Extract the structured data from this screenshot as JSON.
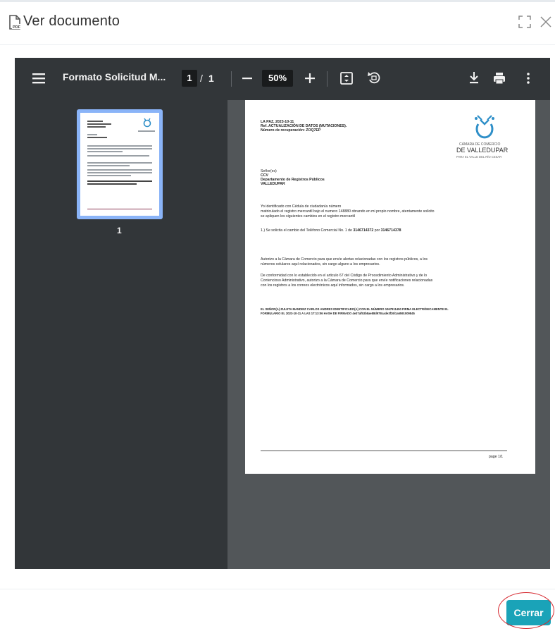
{
  "modal": {
    "title": "Ver documento",
    "title_icon": "pdf-file-icon",
    "expand_icon": "fullscreen-icon",
    "close_icon": "close-icon",
    "close_button_label": "Cerrar",
    "accent_color": "#1aa3b8"
  },
  "viewer": {
    "doc_title": "Formato Solicitud M...",
    "page_current": "1",
    "page_separator": "/",
    "page_total": "1",
    "zoom": "50%",
    "thumbnail_label": "1",
    "toolbar_icons": [
      "menu-icon",
      "zoom-out-icon",
      "zoom-in-icon",
      "fit-page-icon",
      "rotate-icon",
      "download-icon",
      "print-icon",
      "more-icon"
    ]
  },
  "document": {
    "line1": "LA PAZ, 2023-10-11",
    "line2": "Ref. ACTUALIZACIÓN DE DATOS (MUTACIONES).",
    "line3": "Número de recuperación: ZOQ7EP",
    "logo_line1": "CÁMARA DE COMERCIO",
    "logo_line2": "DE VALLEDUPAR",
    "logo_line3": "PARA EL VALLE DEL RÍO CESAR",
    "salutation": "Señor(es)",
    "addr1": "CCV",
    "addr2": "Departamento de Registros Públicos",
    "addr3": "VALLEDUPAR",
    "p1a": "Yo                                                              identificado con Cédula de ciudadanía número",
    "p1b": "matriculado el registro mercantil bajo el numero 148880 obrando en mi propio nombre, atentamente solicito",
    "p1c": "se apliquen los siguientes cambios en el registro mercantil",
    "p2_prefix": "1.) Se solicita el cambio del Teléfono Comercial No. 1 de ",
    "p2_old": "3146714372",
    "p2_mid": " por ",
    "p2_new": "3146714378",
    "p3a": "Autorizo a la Cámara de Comercio para que envíe alertas relacionadas con los registros públicos, a los",
    "p3b": "números celulares aquí relacionados, sin cargo alguno a los empresarios.",
    "p4a": "De conformidad con lo establecido en el articulo 67 del Código de Procedimiento Administrativo y de lo",
    "p4b": "Contencioso Administrativo, autorizo a la Cámara de Comercio para que envíe notificaciones relacionadas",
    "p4c": "con los registros a los correos electrónicos aquí informados, sin cargo a los empresarios.",
    "p5a": "EL SEÑOR(A) ZULETA MANDIEZ CARLOS ANDRES IDENTIFICADO(A) CON EL NÚMERO 1067911450 FIRMA ELECTRÓNICAMENTE EL",
    "p5b": "FORMULARIO EL 2023-10-11 A LAS 17:13:06 HASH DE FIRMADO 4e37af53b8ae88d978cade3f26/1a6591009845",
    "page_footer": "page 1/1"
  }
}
